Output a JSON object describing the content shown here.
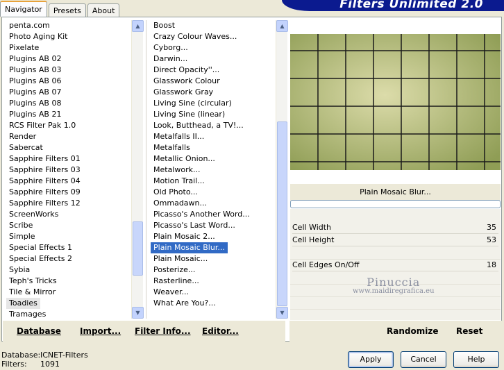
{
  "tabs": [
    {
      "label": "Navigator",
      "active": true
    },
    {
      "label": "Presets",
      "active": false
    },
    {
      "label": "About",
      "active": false
    }
  ],
  "brand": "Filters Unlimited 2.0",
  "categories": {
    "items": [
      "penta.com",
      "Photo Aging Kit",
      "Pixelate",
      "Plugins AB 02",
      "Plugins AB 03",
      "Plugins AB 06",
      "Plugins AB 07",
      "Plugins AB 08",
      "Plugins AB 21",
      "RCS Filter Pak 1.0",
      "Render",
      "Sabercat",
      "Sapphire Filters 01",
      "Sapphire Filters 03",
      "Sapphire Filters 04",
      "Sapphire Filters 09",
      "Sapphire Filters 12",
      "ScreenWorks",
      "Scribe",
      "Simple",
      "Special Effects 1",
      "Special Effects 2",
      "Sybia",
      "Teph's Tricks",
      "Tile & Mirror",
      "Toadies",
      "Tramages"
    ],
    "highlighted_index": 25
  },
  "filters": {
    "items": [
      "Boost",
      "Crazy Colour Waves...",
      "Cyborg...",
      "Darwin...",
      "Direct Opacity''...",
      "Glasswork Colour",
      "Glasswork Gray",
      "Living Sine (circular)",
      "Living Sine (linear)",
      "Look, Butthead, a TV!...",
      "Metalfalls II...",
      "Metalfalls",
      "Metallic Onion...",
      "Metalwork...",
      "Motion Trail...",
      "Old Photo...",
      "Ommadawn...",
      "Picasso's Another Word...",
      "Picasso's Last Word...",
      "Plain Mosaic 2...",
      "Plain Mosaic Blur...",
      "Plain Mosaic...",
      "Posterize...",
      "Rasterline...",
      "Weaver...",
      "What Are You?..."
    ],
    "selected_index": 20
  },
  "preview": {
    "colors": {
      "dark": "#8f9d55",
      "light": "#dcdcaa",
      "grid": "#1a1a1a"
    }
  },
  "filter_name": "Plain Mosaic Blur...",
  "params": [
    {
      "label": "Cell Width",
      "value": "35"
    },
    {
      "label": "Cell Height",
      "value": "53"
    },
    {
      "label": "Cell Edges On/Off",
      "value": "18"
    }
  ],
  "watermark": {
    "line1": "Pinuccia",
    "line2": "www.maidiregrafica.eu"
  },
  "left_buttons": {
    "database": "Database",
    "import": "Import...",
    "filter_info": "Filter Info...",
    "editor": "Editor..."
  },
  "right_buttons": {
    "randomize": "Randomize",
    "reset": "Reset"
  },
  "status": {
    "database_label": "Database:",
    "database_value": "ICNET-Filters",
    "filters_label": "Filters:",
    "filters_value": "1091"
  },
  "dialog_buttons": {
    "apply": "Apply",
    "cancel": "Cancel",
    "help": "Help"
  }
}
